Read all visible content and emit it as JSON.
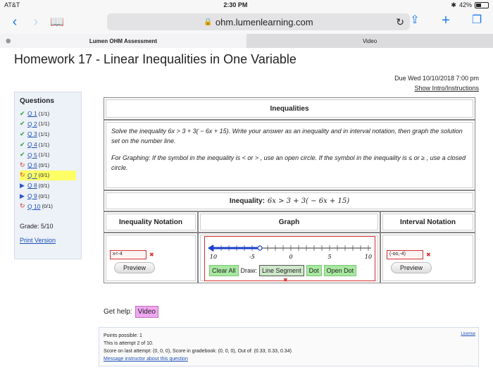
{
  "status": {
    "carrier": "AT&T",
    "time": "2:30 PM",
    "battery": "42%",
    "battery_level": 0.42
  },
  "browser": {
    "url": "ohm.lumenlearning.com"
  },
  "tabs": [
    {
      "label": "Lumen OHM Assessment"
    },
    {
      "label": "Video"
    }
  ],
  "page": {
    "title": "Homework 17 - Linear Inequalities in One Variable",
    "due": "Due Wed 10/10/2018 7:00 pm",
    "show_intro": "Show Intro/Instructions"
  },
  "sidebar": {
    "heading": "Questions",
    "questions": [
      {
        "label": "Q 1",
        "score": "(1/1)",
        "icon": "check-icon"
      },
      {
        "label": "Q 2",
        "score": "(1/1)",
        "icon": "check-icon"
      },
      {
        "label": "Q 3",
        "score": "(1/1)",
        "icon": "check-icon"
      },
      {
        "label": "Q 4",
        "score": "(1/1)",
        "icon": "check-icon"
      },
      {
        "label": "Q 5",
        "score": "(1/1)",
        "icon": "check-icon"
      },
      {
        "label": "Q 6",
        "score": "(0/1)",
        "icon": "retry-icon"
      },
      {
        "label": "Q 7",
        "score": "(0/1)",
        "icon": "retry-icon"
      },
      {
        "label": "Q 8",
        "score": "(0/1)",
        "icon": "play-icon"
      },
      {
        "label": "Q 9",
        "score": "(0/1)",
        "icon": "play-icon"
      },
      {
        "label": "Q 10",
        "score": "(0/1)",
        "icon": "retry-icon"
      }
    ],
    "grade": "Grade: 5/10",
    "print": "Print Version"
  },
  "problem": {
    "heading": "Inequalities",
    "instruction": "Solve the inequality 6x > 3 + 3( − 6x + 15). Write your answer as an inequality and in interval notation, then graph the solution set on the number line.",
    "graphing_note": "For Graphing: If the symbol in the inequality is < or > , use an open circle. If the symbol in the inequality is ≤ or ≥ , use a closed circle.",
    "inequality_label": "Inequality:",
    "inequality": "6x > 3 + 3( − 6x + 15)",
    "col_inequality": "Inequality Notation",
    "col_graph": "Graph",
    "col_interval": "Interval Notation",
    "answer_inequality": "x<-4",
    "answer_interval": "(-oo,-4)",
    "preview": "Preview",
    "clear_all": "Clear All",
    "draw_label": "Draw:",
    "draw_options": [
      "Line Segment",
      "Dot",
      "Open Dot"
    ],
    "axis_labels": [
      "10",
      "-5",
      "0",
      "5",
      "10"
    ]
  },
  "help": {
    "label": "Get help:",
    "video": "Video"
  },
  "footer": {
    "points": "Points possible: 1",
    "attempt": "This is attempt 2 of 10.",
    "score": "Score on last attempt: (0, 0, 0), Score in gradebook: (0, 0, 0), Out of: (0.33, 0.33, 0.34)",
    "message": "Message instructor about this question",
    "license": "License"
  }
}
